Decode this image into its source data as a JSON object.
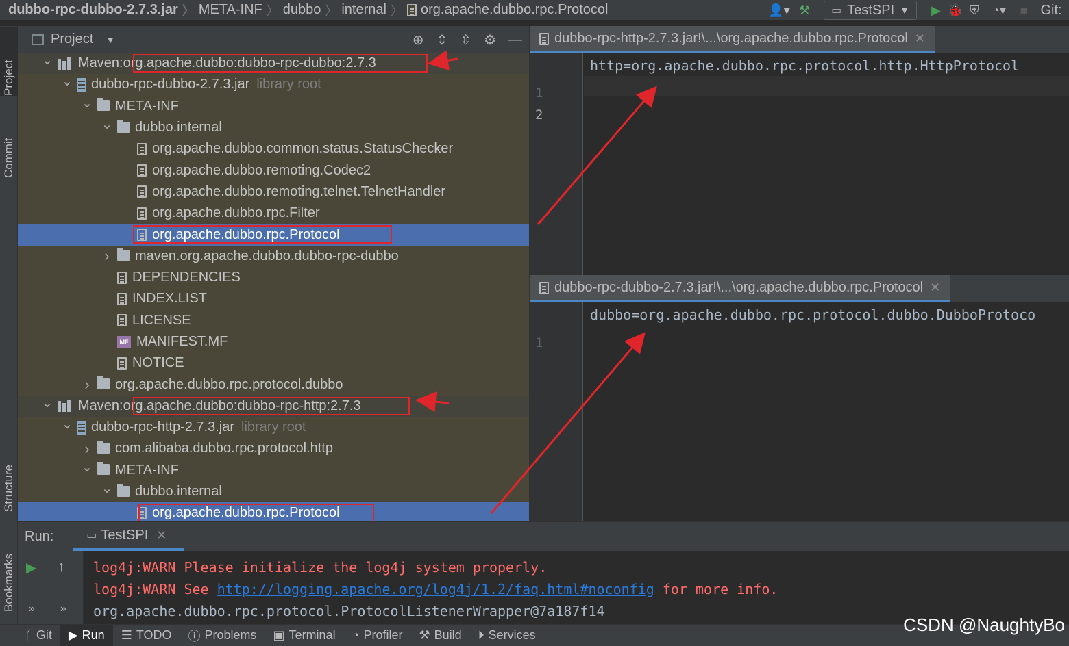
{
  "breadcrumb": [
    "dubbo-rpc-dubbo-2.7.3.jar",
    "META-INF",
    "dubbo",
    "internal",
    "org.apache.dubbo.rpc.Protocol"
  ],
  "toolbar": {
    "run_config": "TestSPI",
    "git_label": "Git:"
  },
  "stripe": {
    "project": "Project",
    "commit": "Commit",
    "structure": "Structure",
    "bookmarks": "Bookmarks"
  },
  "project_panel": {
    "title": "Project"
  },
  "tree": [
    {
      "label": "Maven: org.apache.dubbo:dubbo-rpc-dubbo:2.7.3",
      "prefix": "Maven:",
      "name": "org.apache.dubbo:dubbo-rpc-dubbo:2.7.3",
      "type": "maven",
      "expanded": true
    },
    {
      "label": "dubbo-rpc-dubbo-2.7.3.jar",
      "suffix": "library root",
      "type": "jar",
      "expanded": true
    },
    {
      "label": "META-INF",
      "type": "folder",
      "expanded": true
    },
    {
      "label": "dubbo.internal",
      "type": "folder",
      "expanded": true
    },
    {
      "label": "org.apache.dubbo.common.status.StatusChecker",
      "type": "file"
    },
    {
      "label": "org.apache.dubbo.remoting.Codec2",
      "type": "file"
    },
    {
      "label": "org.apache.dubbo.remoting.telnet.TelnetHandler",
      "type": "file"
    },
    {
      "label": "org.apache.dubbo.rpc.Filter",
      "type": "file"
    },
    {
      "label": "org.apache.dubbo.rpc.Protocol",
      "type": "file",
      "selected": true
    },
    {
      "label": "maven.org.apache.dubbo.dubbo-rpc-dubbo",
      "type": "folder",
      "expanded": false
    },
    {
      "label": "DEPENDENCIES",
      "type": "file"
    },
    {
      "label": "INDEX.LIST",
      "type": "file"
    },
    {
      "label": "LICENSE",
      "type": "file"
    },
    {
      "label": "MANIFEST.MF",
      "type": "mf"
    },
    {
      "label": "NOTICE",
      "type": "file"
    },
    {
      "label": "org.apache.dubbo.rpc.protocol.dubbo",
      "type": "folder",
      "expanded": false
    },
    {
      "label": "Maven: org.apache.dubbo:dubbo-rpc-http:2.7.3",
      "prefix": "Maven:",
      "name": "org.apache.dubbo:dubbo-rpc-http:2.7.3",
      "type": "maven",
      "expanded": true
    },
    {
      "label": "dubbo-rpc-http-2.7.3.jar",
      "suffix": "library root",
      "type": "jar",
      "expanded": true
    },
    {
      "label": "com.alibaba.dubbo.rpc.protocol.http",
      "type": "folder",
      "expanded": false
    },
    {
      "label": "META-INF",
      "type": "folder",
      "expanded": true
    },
    {
      "label": "dubbo.internal",
      "type": "folder",
      "expanded": true
    },
    {
      "label": "org.apache.dubbo.rpc.Protocol",
      "type": "file",
      "selected": true
    }
  ],
  "editor_top": {
    "tab": "dubbo-rpc-http-2.7.3.jar!\\...\\org.apache.dubbo.rpc.Protocol",
    "line_numbers": [
      "1",
      "2"
    ],
    "lines": [
      "http=org.apache.dubbo.rpc.protocol.http.HttpProtocol"
    ]
  },
  "editor_bottom": {
    "tab": "dubbo-rpc-dubbo-2.7.3.jar!\\...\\org.apache.dubbo.rpc.Protocol",
    "line_numbers": [
      "1"
    ],
    "lines": [
      "dubbo=org.apache.dubbo.rpc.protocol.dubbo.DubboProtoco"
    ]
  },
  "run_panel": {
    "label": "Run:",
    "tab": "TestSPI",
    "console": {
      "line1": "log4j:WARN Please initialize the log4j system properly.",
      "line2_prefix": "log4j:WARN See ",
      "line2_link": "http://logging.apache.org/log4j/1.2/faq.html#noconfig",
      "line2_suffix": " for more info.",
      "line3": "org.apache.dubbo.rpc.protocol.ProtocolListenerWrapper@7a187f14"
    }
  },
  "bottom_tabs": [
    "Git",
    "Run",
    "TODO",
    "Problems",
    "Terminal",
    "Profiler",
    "Build",
    "Services"
  ],
  "watermark": "CSDN @NaughtyBo",
  "colors": {
    "selection": "#4b6eaf",
    "annotation_red": "#e0262a",
    "tree_bg": "#4a4638"
  }
}
